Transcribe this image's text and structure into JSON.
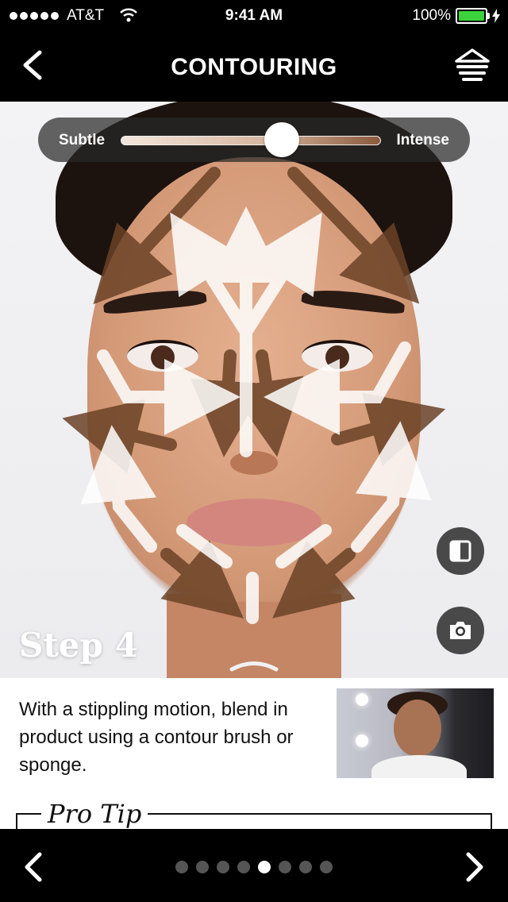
{
  "status_bar": {
    "carrier": "AT&T",
    "time": "9:41 AM",
    "battery": "100%",
    "battery_color": "#3bd23b"
  },
  "nav": {
    "title": "CONTOURING",
    "back_icon": "chevron-left-icon",
    "menu_icon": "layers-menu-icon"
  },
  "slider": {
    "left_label": "Subtle",
    "right_label": "Intense",
    "value_fraction": 0.62
  },
  "photo": {
    "step_label": "Step 4",
    "compare_icon": "split-view-icon",
    "camera_icon": "camera-icon",
    "pull_icon": "chevron-up-icon",
    "highlight_color": "#ffffff",
    "contour_color": "#6b4226"
  },
  "content": {
    "description": "With a stippling motion, blend in product using a contour brush or sponge.",
    "pro_tip_label": "Pro Tip"
  },
  "pager": {
    "count": 8,
    "active_index": 4
  },
  "bottom_nav": {
    "prev_icon": "chevron-left-icon",
    "next_icon": "chevron-right-icon"
  }
}
